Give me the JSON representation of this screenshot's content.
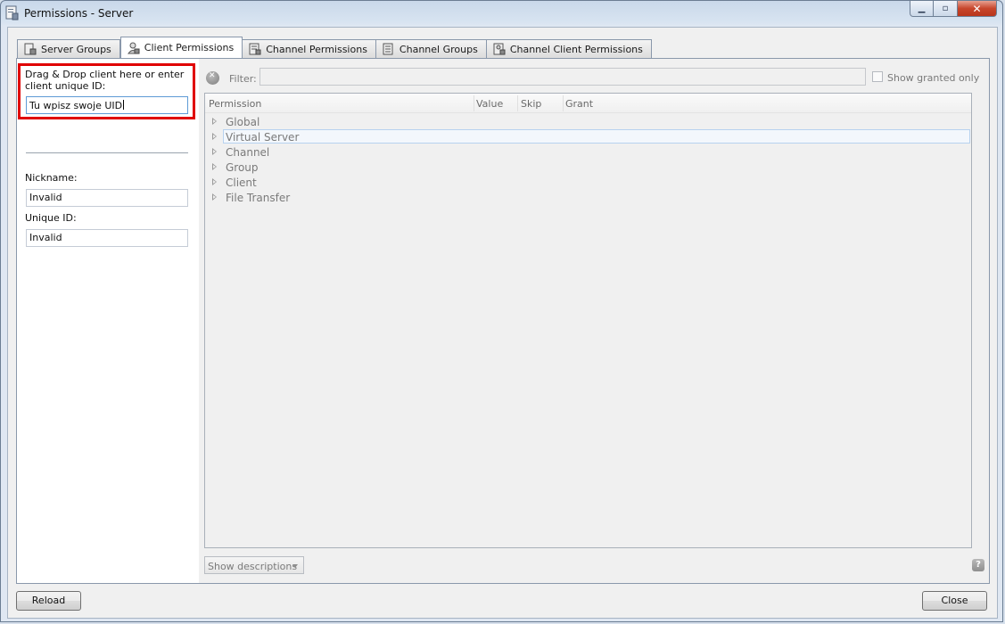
{
  "window": {
    "title": "Permissions - Server"
  },
  "tabs": [
    {
      "label": "Server Groups",
      "icon": "server-groups-icon"
    },
    {
      "label": "Client Permissions",
      "icon": "client-permissions-icon",
      "active": true
    },
    {
      "label": "Channel Permissions",
      "icon": "channel-permissions-icon"
    },
    {
      "label": "Channel Groups",
      "icon": "channel-groups-icon"
    },
    {
      "label": "Channel Client Permissions",
      "icon": "channel-client-permissions-icon"
    }
  ],
  "left": {
    "drop_label": "Drag & Drop client here or enter client unique ID:",
    "uid_input_value": "Tu wpisz swoje UID",
    "nickname_label": "Nickname:",
    "nickname_value": "Invalid",
    "unique_id_label": "Unique ID:",
    "unique_id_value": "Invalid"
  },
  "filter": {
    "label": "Filter:",
    "value": "",
    "show_granted_label": "Show granted only",
    "show_granted_checked": false
  },
  "tree": {
    "columns": [
      "Permission",
      "Value",
      "Skip",
      "Grant"
    ],
    "rows": [
      {
        "label": "Global",
        "selected": false
      },
      {
        "label": "Virtual Server",
        "selected": true
      },
      {
        "label": "Channel",
        "selected": false
      },
      {
        "label": "Group",
        "selected": false
      },
      {
        "label": "Client",
        "selected": false
      },
      {
        "label": "File Transfer",
        "selected": false
      }
    ]
  },
  "bottom": {
    "descriptions_select": "Show descriptions",
    "help_glyph": "?"
  },
  "footer": {
    "reload_label": "Reload",
    "close_label": "Close"
  }
}
